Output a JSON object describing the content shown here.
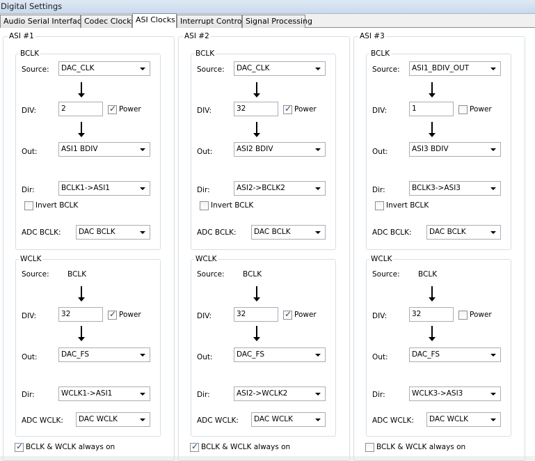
{
  "window": {
    "title": "Digital Settings"
  },
  "tabs": [
    "Audio Serial Interface",
    "Codec Clocks",
    "ASI Clocks",
    "Interrupt Control",
    "Signal Processing"
  ],
  "active_tab": "ASI Clocks",
  "labels": {
    "bclk_group": "BCLK",
    "wclk_group": "WCLK",
    "source": "Source:",
    "div": "DIV:",
    "out": "Out:",
    "dir": "Dir:",
    "power": "Power",
    "invert_bclk": "Invert BCLK",
    "adc_bclk": "ADC BCLK:",
    "adc_wclk": "ADC WCLK:",
    "always_on": "BCLK & WCLK always on"
  },
  "asi": [
    {
      "title": "ASI #1",
      "bclk": {
        "source": "DAC_CLK",
        "div": "2",
        "power": true,
        "out": "ASI1 BDIV",
        "dir": "BCLK1->ASI1",
        "invert": false,
        "adc": "DAC BCLK"
      },
      "wclk": {
        "source": "BCLK",
        "div": "32",
        "power": true,
        "out": "DAC_FS",
        "dir": "WCLK1->ASI1",
        "adc": "DAC WCLK"
      },
      "always_on": true
    },
    {
      "title": "ASI #2",
      "bclk": {
        "source": "DAC_CLK",
        "div": "32",
        "power": true,
        "out": "ASI2 BDIV",
        "dir": "ASI2->BCLK2",
        "invert": false,
        "adc": "DAC BCLK"
      },
      "wclk": {
        "source": "BCLK",
        "div": "32",
        "power": true,
        "out": "DAC_FS",
        "dir": "ASI2->WCLK2",
        "adc": "DAC WCLK"
      },
      "always_on": true
    },
    {
      "title": "ASI #3",
      "bclk": {
        "source": "ASI1_BDIV_OUT",
        "div": "1",
        "power": false,
        "out": "ASI3 BDIV",
        "dir": "BCLK3->ASI3",
        "invert": false,
        "adc": "DAC BCLK"
      },
      "wclk": {
        "source": "BCLK",
        "div": "32",
        "power": false,
        "out": "DAC_FS",
        "dir": "WCLK3->ASI3",
        "adc": "DAC WCLK"
      },
      "always_on": false
    }
  ]
}
